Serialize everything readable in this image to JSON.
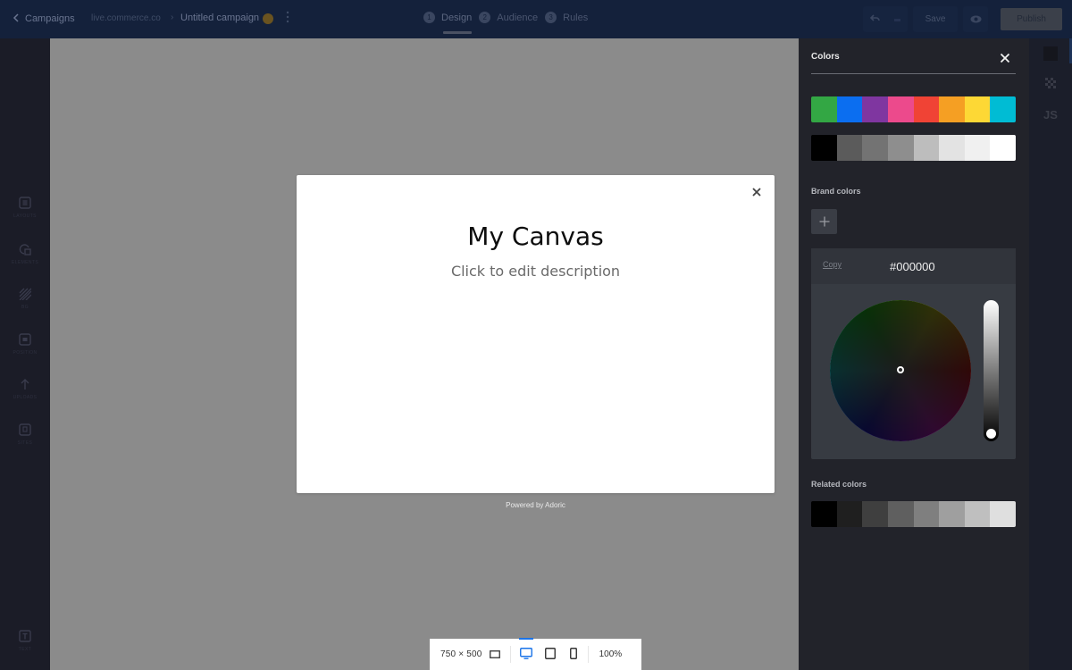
{
  "topbar": {
    "back_label": "Campaigns",
    "site": "live.commerce.co",
    "separator": "›",
    "campaign_title": "Untitled campaign",
    "status_color": "#6a5320",
    "steps": [
      {
        "num": "1",
        "label": "Design",
        "active": true
      },
      {
        "num": "2",
        "label": "Audience",
        "active": false
      },
      {
        "num": "3",
        "label": "Rules",
        "active": false
      }
    ],
    "save_label": "Save",
    "publish_label": "Publish"
  },
  "sidebar": {
    "items": [
      {
        "label": "Layouts",
        "icon": "layouts-icon"
      },
      {
        "label": "Elements",
        "icon": "elements-icon"
      },
      {
        "label": "BG",
        "icon": "background-icon"
      },
      {
        "label": "Position",
        "icon": "position-icon"
      },
      {
        "label": "Uploads",
        "icon": "upload-icon"
      },
      {
        "label": "Sites",
        "icon": "sites-icon"
      }
    ],
    "bottom_item": {
      "label": "Text",
      "icon": "text-icon"
    }
  },
  "canvas": {
    "popup_title": "My Canvas",
    "popup_description": "Click to edit description",
    "powered_by": "Powered by Adoric"
  },
  "bottom_bar": {
    "size": "750 × 500",
    "zoom": "100%",
    "active_device": "desktop"
  },
  "colors_panel": {
    "title": "Colors",
    "palette_vivid": [
      "#33a744",
      "#0b6ef0",
      "#7f36a0",
      "#ec4a8c",
      "#f04335",
      "#f59f23",
      "#fdd835",
      "#00bcd4"
    ],
    "palette_grays": [
      "#000000",
      "#5b5b5b",
      "#737373",
      "#8e8e8e",
      "#bdbdbd",
      "#e3e3e3",
      "#f0f0f0",
      "#ffffff"
    ],
    "brand_label": "Brand colors",
    "copy_label": "Copy",
    "hex_value": "#000000",
    "related_label": "Related colors",
    "related_colors": [
      "#000000",
      "#1f1f1f",
      "#3f3f3f",
      "#5f5f5f",
      "#7f7f7f",
      "#9f9f9f",
      "#bfbfbf",
      "#dfdfdf"
    ],
    "lightness": 0
  },
  "right_strip": {
    "js_label": "JS"
  }
}
